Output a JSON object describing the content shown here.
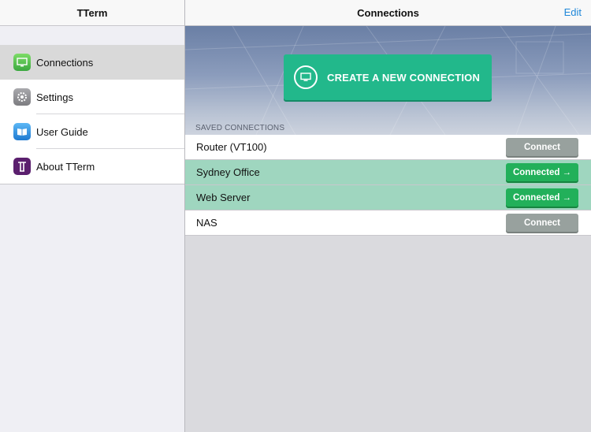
{
  "sidebar": {
    "title": "TTerm",
    "items": [
      {
        "label": "Connections",
        "icon": "monitor-icon",
        "selected": true
      },
      {
        "label": "Settings",
        "icon": "gear-icon",
        "selected": false
      },
      {
        "label": "User Guide",
        "icon": "book-icon",
        "selected": false
      },
      {
        "label": "About TTerm",
        "icon": "tterm-logo-icon",
        "selected": false
      }
    ]
  },
  "main": {
    "title": "Connections",
    "edit_label": "Edit",
    "create_label": "CREATE A NEW CONNECTION",
    "saved_header": "SAVED CONNECTIONS",
    "connections": [
      {
        "name": "Router (VT100)",
        "status_label": "Connect",
        "connected": false
      },
      {
        "name": "Sydney Office",
        "status_label": "Connected →",
        "connected": true
      },
      {
        "name": "Web Server",
        "status_label": "Connected →",
        "connected": true
      },
      {
        "name": "NAS",
        "status_label": "Connect",
        "connected": false
      }
    ]
  },
  "colors": {
    "accent": "#1f87d9",
    "create_button": "#22b88b",
    "connected_button": "#22b05a",
    "connect_button": "#98a19e",
    "active_row": "#9fd6bf"
  }
}
